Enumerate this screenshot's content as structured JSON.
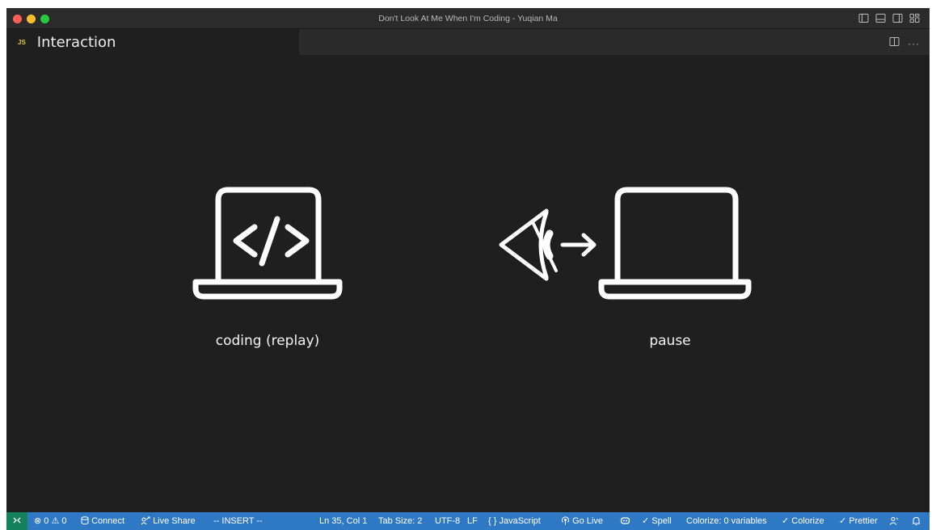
{
  "window": {
    "title": "Don't Look At Me When I'm Coding - Yuqian Ma"
  },
  "tab": {
    "badge": "JS",
    "label": "Interaction"
  },
  "illustrations": [
    {
      "caption": "coding (replay)",
      "icon": "laptop-code-icon"
    },
    {
      "caption": "pause",
      "icon": "eye-arrow-laptop-icon"
    }
  ],
  "statusbar": {
    "remote_icon": "remote-icon",
    "problems": "⊗ 0 ⚠ 0",
    "connect": "Connect",
    "live_share": "Live Share",
    "mode": "-- INSERT --",
    "position": "Ln 35, Col 1",
    "tab_size": "Tab Size: 2",
    "encoding": "UTF-8",
    "eol": "LF",
    "language": "{ } JavaScript",
    "go_live": "Go Live",
    "spell": "✓ Spell",
    "colorize_vars": "Colorize: 0 variables",
    "colorize": "✓ Colorize",
    "prettier": "✓ Prettier"
  },
  "colors": {
    "editor_bg": "#1f1f1f",
    "statusbar_bg": "#2f78c4",
    "remote_bg": "#16825d",
    "js_badge": "#e8c33c"
  }
}
